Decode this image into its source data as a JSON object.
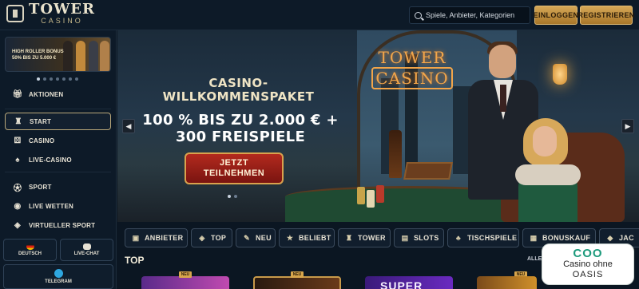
{
  "header": {
    "logo_main": "TOWER",
    "logo_sub": "CASINO",
    "search_placeholder": "Spiele, Anbieter, Kategorien",
    "login_label": "EINLOGGEN",
    "register_label": "REGISTRIEREN"
  },
  "sidebar": {
    "promo": {
      "line1": "HIGH ROLLER BONUS",
      "line2": "50% BIS ZU 5.000 €"
    },
    "promo_dots": {
      "count": 7,
      "active_index": 0
    },
    "items": [
      {
        "label": "AKTIONEN",
        "icon": "gift-icon"
      },
      {
        "label": "START",
        "icon": "tower-icon",
        "active": true
      },
      {
        "label": "CASINO",
        "icon": "dice-icon"
      },
      {
        "label": "LIVE-CASINO",
        "icon": "cards-icon"
      },
      {
        "label": "SPORT",
        "icon": "ball-icon"
      },
      {
        "label": "LIVE WETTEN",
        "icon": "broadcast-icon"
      },
      {
        "label": "VIRTUELLER SPORT",
        "icon": "controller-icon"
      }
    ],
    "language_label": "DEUTSCH",
    "chat_label": "LIVE-CHAT",
    "telegram_label": "TELEGRAM"
  },
  "hero": {
    "logo_line1": "TOWER",
    "logo_line2": "CASINO",
    "title_line1": "CASINO-",
    "title_line2": "WILLKOMMENSPAKET",
    "offer_line1": "100 % BIS ZU 2.000 € +",
    "offer_line2": "300 FREISPIELE",
    "cta_line1": "JETZT",
    "cta_line2": "TEILNEHMEN",
    "slide_count": 2,
    "active_slide": 0
  },
  "categories": [
    {
      "label": "ANBIETER",
      "icon": "provider-icon"
    },
    {
      "label": "TOP",
      "icon": "shield-icon"
    },
    {
      "label": "NEU",
      "icon": "new-icon"
    },
    {
      "label": "BELIEBT",
      "icon": "star-icon"
    },
    {
      "label": "TOWER",
      "icon": "tower-icon"
    },
    {
      "label": "SLOTS",
      "icon": "slots-icon"
    },
    {
      "label": "TISCHSPIELE",
      "icon": "table-games-icon"
    },
    {
      "label": "BONUSKAUF",
      "icon": "bonus-buy-icon"
    },
    {
      "label": "JAC",
      "icon": "jackpot-icon"
    }
  ],
  "section": {
    "title": "TOP",
    "view_all": "ALLES",
    "new_badge": "NEU",
    "game_text": "SUPER"
  },
  "overlay_badge": {
    "line1": "COO",
    "line2": "Casino ohne",
    "line3": "OASIS"
  },
  "colors": {
    "gold": "#d6a756",
    "accent_red": "#b32a1e",
    "badge_green": "#1d9a7c"
  }
}
